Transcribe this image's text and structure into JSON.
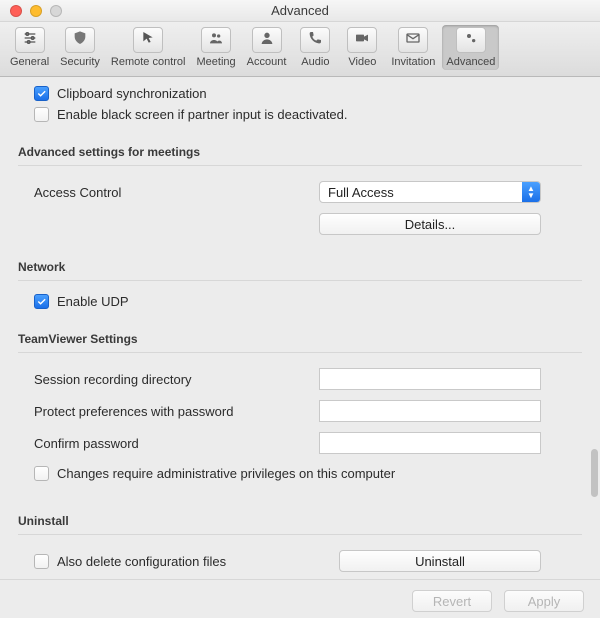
{
  "window": {
    "title": "Advanced"
  },
  "toolbar": {
    "items": [
      {
        "label": "General",
        "icon": "sliders"
      },
      {
        "label": "Security",
        "icon": "shield"
      },
      {
        "label": "Remote control",
        "icon": "cursor"
      },
      {
        "label": "Meeting",
        "icon": "group"
      },
      {
        "label": "Account",
        "icon": "person"
      },
      {
        "label": "Audio",
        "icon": "phone"
      },
      {
        "label": "Video",
        "icon": "camera"
      },
      {
        "label": "Invitation",
        "icon": "envelope"
      },
      {
        "label": "Advanced",
        "icon": "gears",
        "active": true
      }
    ]
  },
  "topchecks": {
    "clipboard": {
      "label": "Clipboard synchronization",
      "checked": true
    },
    "blackscreen": {
      "label": "Enable black screen if partner input is deactivated.",
      "checked": false
    }
  },
  "meetings": {
    "title": "Advanced settings for meetings",
    "access_label": "Access Control",
    "access_value": "Full Access",
    "details_btn": "Details..."
  },
  "network": {
    "title": "Network",
    "udp": {
      "label": "Enable UDP",
      "checked": true
    }
  },
  "tvsettings": {
    "title": "TeamViewer Settings",
    "recdir_label": "Session recording directory",
    "recdir_value": "",
    "protect_label": "Protect preferences with password",
    "protect_value": "",
    "confirm_label": "Confirm password",
    "confirm_value": "",
    "adminpriv": {
      "label": "Changes require administrative privileges on this computer",
      "checked": false
    }
  },
  "uninstall": {
    "title": "Uninstall",
    "delcfg": {
      "label": "Also delete configuration files",
      "checked": false
    },
    "btn": "Uninstall"
  },
  "footer": {
    "revert": "Revert",
    "apply": "Apply"
  }
}
